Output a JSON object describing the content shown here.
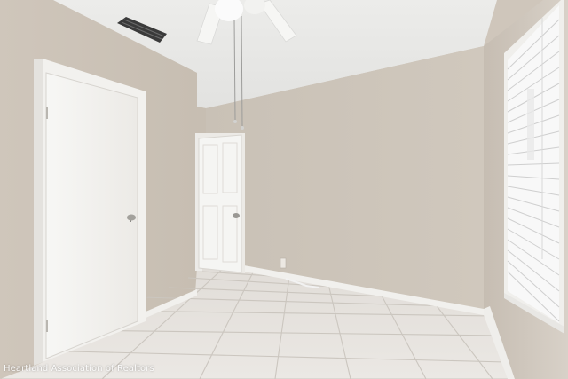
{
  "photo": {
    "watermark": "Heartland Association of Realtors"
  },
  "colors": {
    "wall": "#cdc4b9",
    "ceiling": "#e9e9e7",
    "floor_tile": "#e6e3df",
    "grout": "#cfcac4",
    "door": "#f5f5f3",
    "trim": "#f4f4f2",
    "blinds": "#f7f7f7"
  }
}
